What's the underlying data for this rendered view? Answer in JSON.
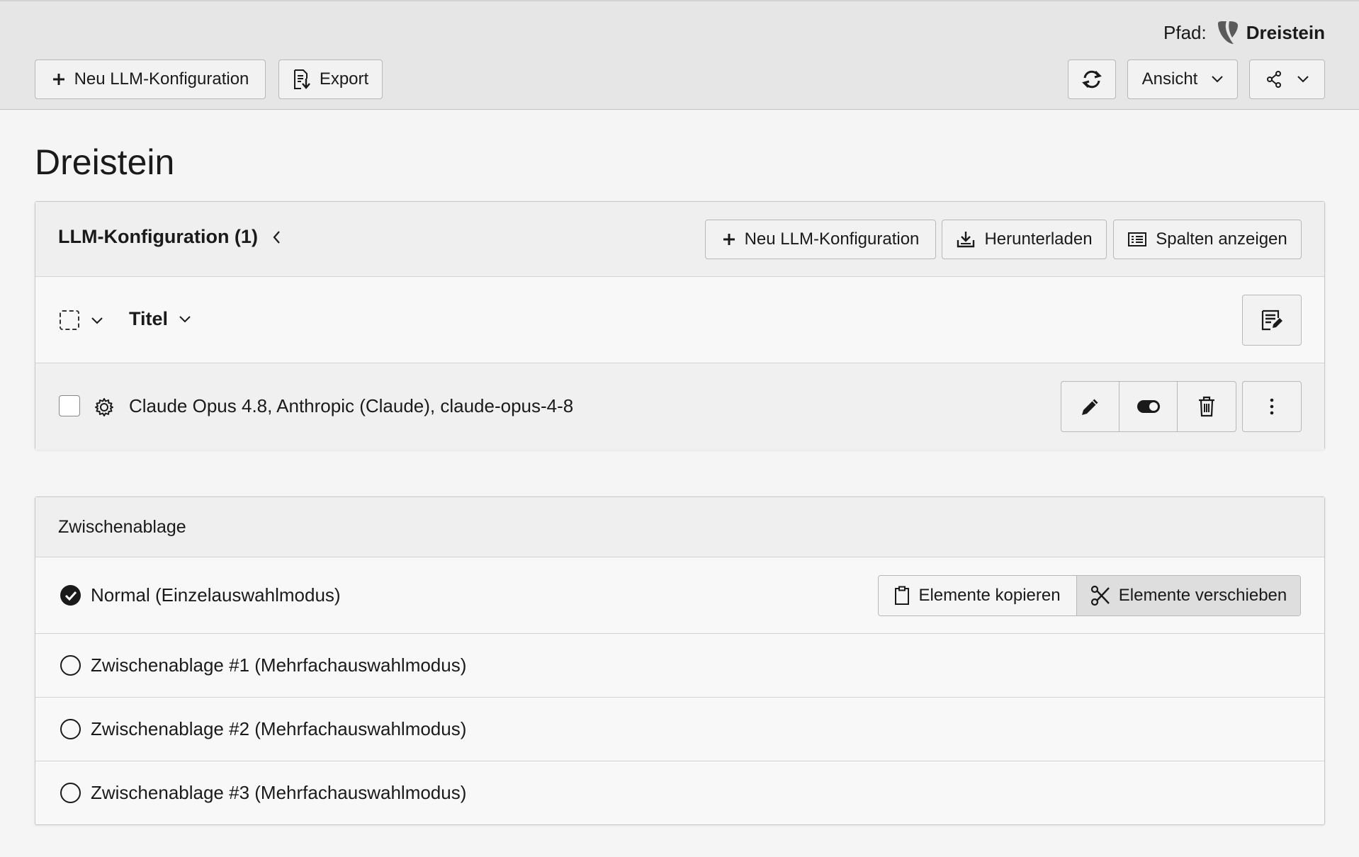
{
  "docheader": {
    "path_label": "Pfad:",
    "path_site": "Dreistein",
    "new_button": "Neu LLM-Konfiguration",
    "export_button": "Export",
    "view_button": "Ansicht"
  },
  "page": {
    "title": "Dreistein"
  },
  "record_list": {
    "title": "LLM-Konfiguration (1)",
    "new_button": "Neu LLM-Konfiguration",
    "download_button": "Herunterladen",
    "columns_button": "Spalten anzeigen",
    "column_title": "Titel",
    "rows": [
      {
        "label": "Claude Opus 4.8, Anthropic (Claude), claude-opus-4-8"
      }
    ]
  },
  "clipboard": {
    "title": "Zwischenablage",
    "copy_button": "Elemente kopieren",
    "move_button": "Elemente verschieben",
    "modes": [
      {
        "label": "Normal (Einzelauswahlmodus)",
        "selected": true
      },
      {
        "label": "Zwischenablage #1 (Mehrfachauswahlmodus)",
        "selected": false
      },
      {
        "label": "Zwischenablage #2 (Mehrfachauswahlmodus)",
        "selected": false
      },
      {
        "label": "Zwischenablage #3 (Mehrfachauswahlmodus)",
        "selected": false
      }
    ]
  },
  "icons": {
    "logo": "typo3-logo-icon",
    "add": "plus-icon",
    "export": "export-icon",
    "refresh": "refresh-icon",
    "share": "share-icon",
    "download": "download-icon",
    "columns": "columns-icon",
    "settings": "gear-icon",
    "edit": "pencil-icon",
    "toggle": "toggle-icon",
    "delete": "trash-icon",
    "more": "more-vertical-icon",
    "multi_edit": "multi-edit-icon",
    "copy": "clipboard-icon",
    "cut": "scissors-icon"
  },
  "colors": {
    "docheader_bg": "#e6e6e6",
    "page_bg": "#f5f5f5",
    "logo": "#5a5a5a"
  }
}
